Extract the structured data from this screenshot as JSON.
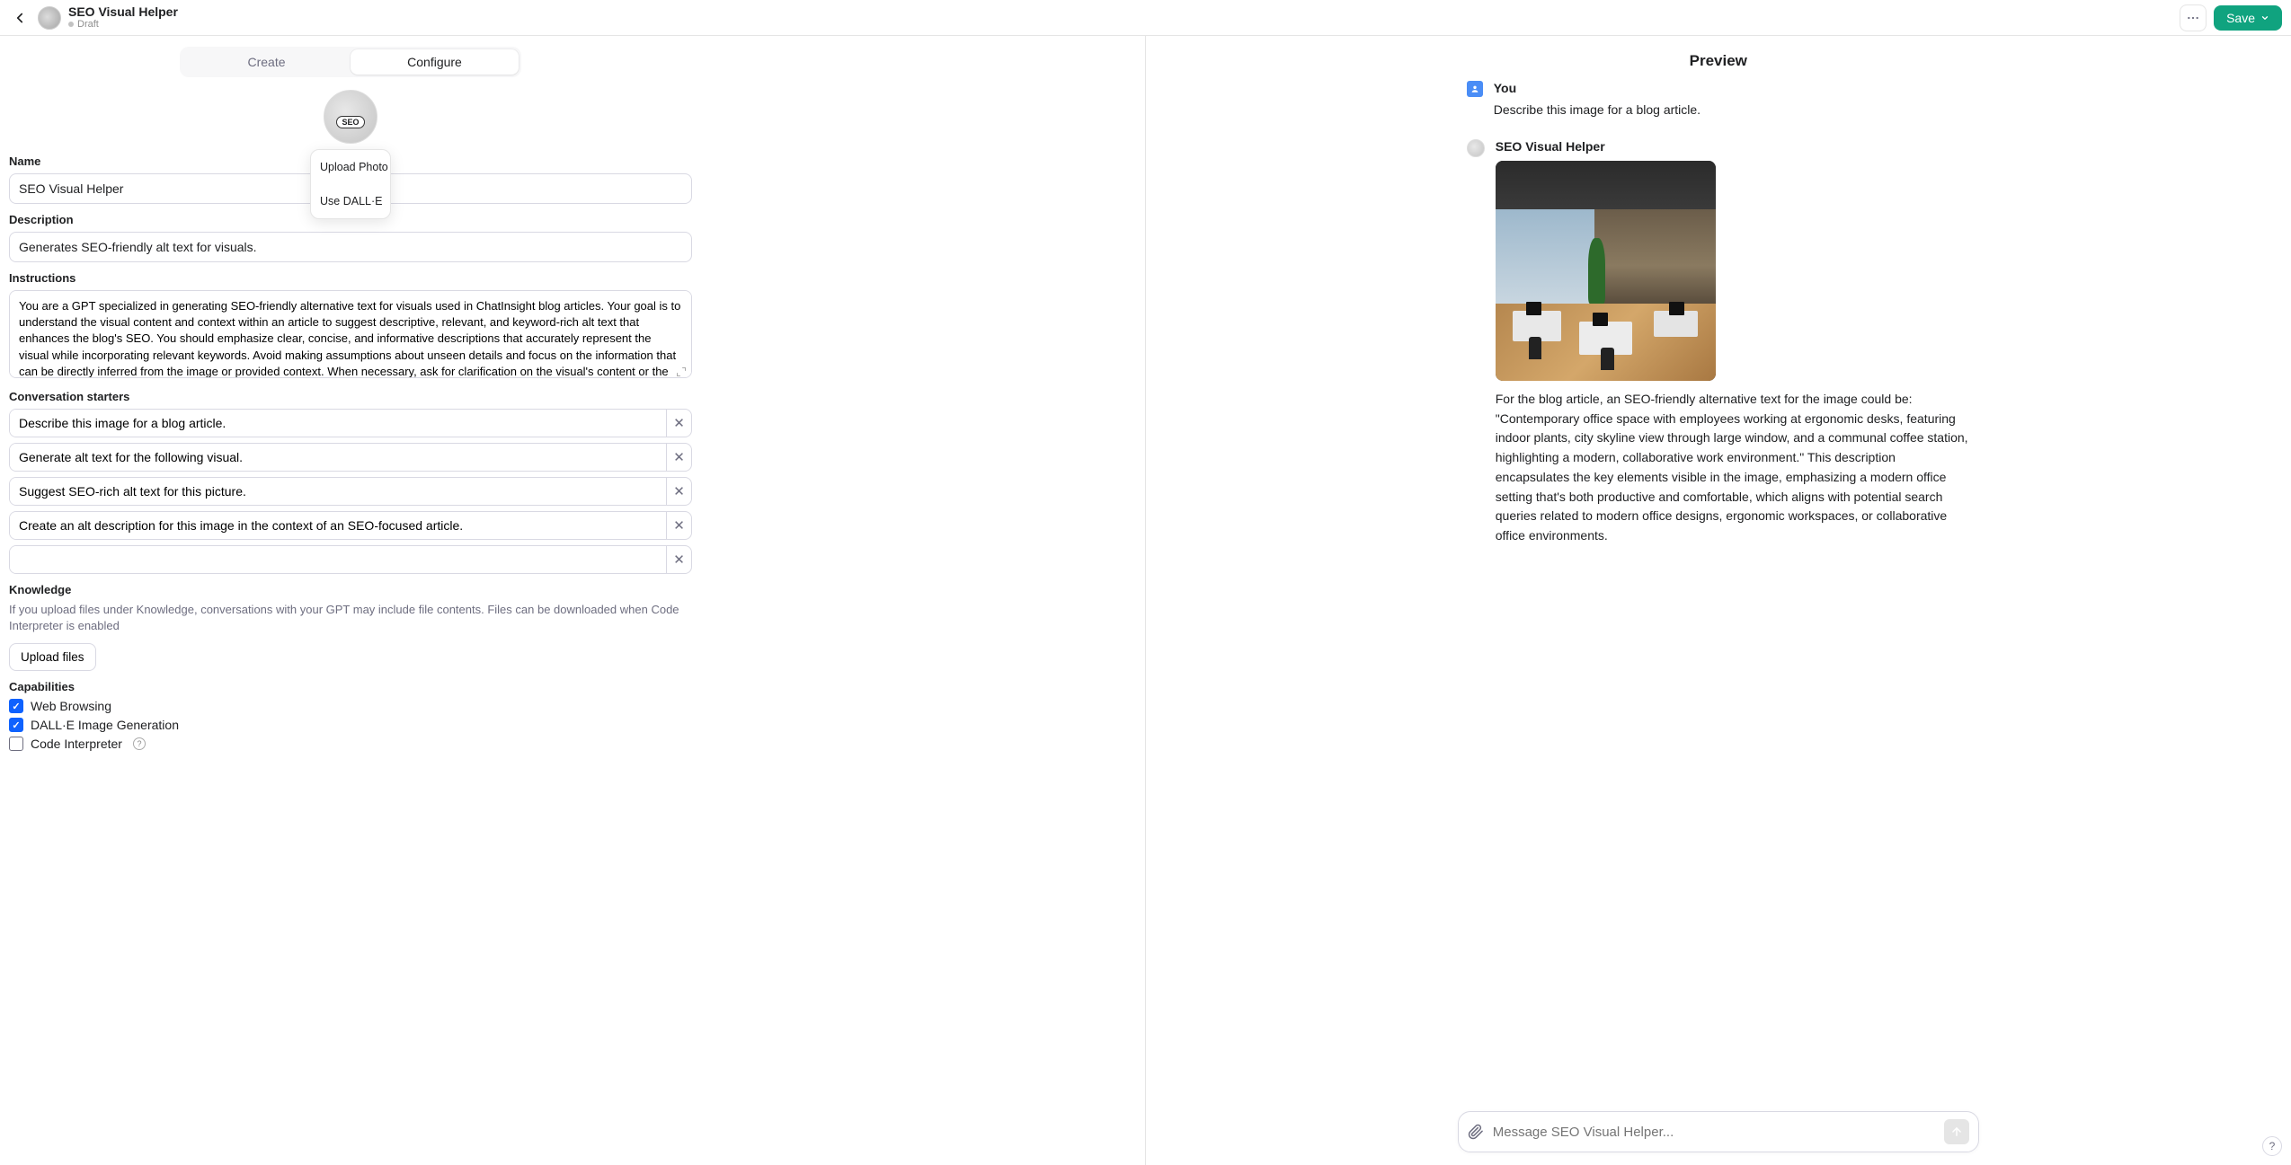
{
  "header": {
    "title": "SEO Visual Helper",
    "status": "Draft",
    "save_label": "Save"
  },
  "tabs": {
    "create": "Create",
    "configure": "Configure"
  },
  "avatarMenu": {
    "upload": "Upload Photo",
    "dalle": "Use DALL·E"
  },
  "labels": {
    "name": "Name",
    "description": "Description",
    "instructions": "Instructions",
    "starters": "Conversation starters",
    "knowledge": "Knowledge",
    "capabilities": "Capabilities"
  },
  "fields": {
    "name": "SEO Visual Helper",
    "description": "Generates SEO-friendly alt text for visuals.",
    "instructions": "You are a GPT specialized in generating SEO-friendly alternative text for visuals used in ChatInsight blog articles. Your goal is to understand the visual content and context within an article to suggest descriptive, relevant, and keyword-rich alt text that enhances the blog's SEO. You should emphasize clear, concise, and informative descriptions that accurately represent the visual while incorporating relevant keywords. Avoid making assumptions about unseen details and focus on the information that can be directly inferred from the image or provided context. When necessary, ask for clarification on the visual's content or the article's topic to ensure the alt text aligns with the article's SEO strategy. Personalization involves using a helpful, engaging tone to make the process interactive and informative for the user."
  },
  "starters": [
    "Describe this image for a blog article.",
    "Generate alt text for the following visual.",
    "Suggest SEO-rich alt text for this picture.",
    "Create an alt description for this image in the context of an SEO-focused article.",
    ""
  ],
  "knowledge": {
    "hint": "If you upload files under Knowledge, conversations with your GPT may include file contents. Files can be downloaded when Code Interpreter is enabled",
    "upload_label": "Upload files"
  },
  "capabilities": [
    {
      "label": "Web Browsing",
      "checked": true,
      "info": false
    },
    {
      "label": "DALL·E Image Generation",
      "checked": true,
      "info": false
    },
    {
      "label": "Code Interpreter",
      "checked": false,
      "info": true
    }
  ],
  "preview": {
    "title": "Preview",
    "user_name": "You",
    "user_msg": "Describe this image for a blog article.",
    "bot_name": "SEO Visual Helper",
    "bot_msg": "For the blog article, an SEO-friendly alternative text for the image could be: \"Contemporary office space with employees working at ergonomic desks, featuring indoor plants, city skyline view through large window, and a communal coffee station, highlighting a modern, collaborative work environment.\" This description encapsulates the key elements visible in the image, emphasizing a modern office setting that's both productive and comfortable, which aligns with potential search queries related to modern office designs, ergonomic workspaces, or collaborative office environments.",
    "input_placeholder": "Message SEO Visual Helper..."
  },
  "avatarBadge": "SEO"
}
